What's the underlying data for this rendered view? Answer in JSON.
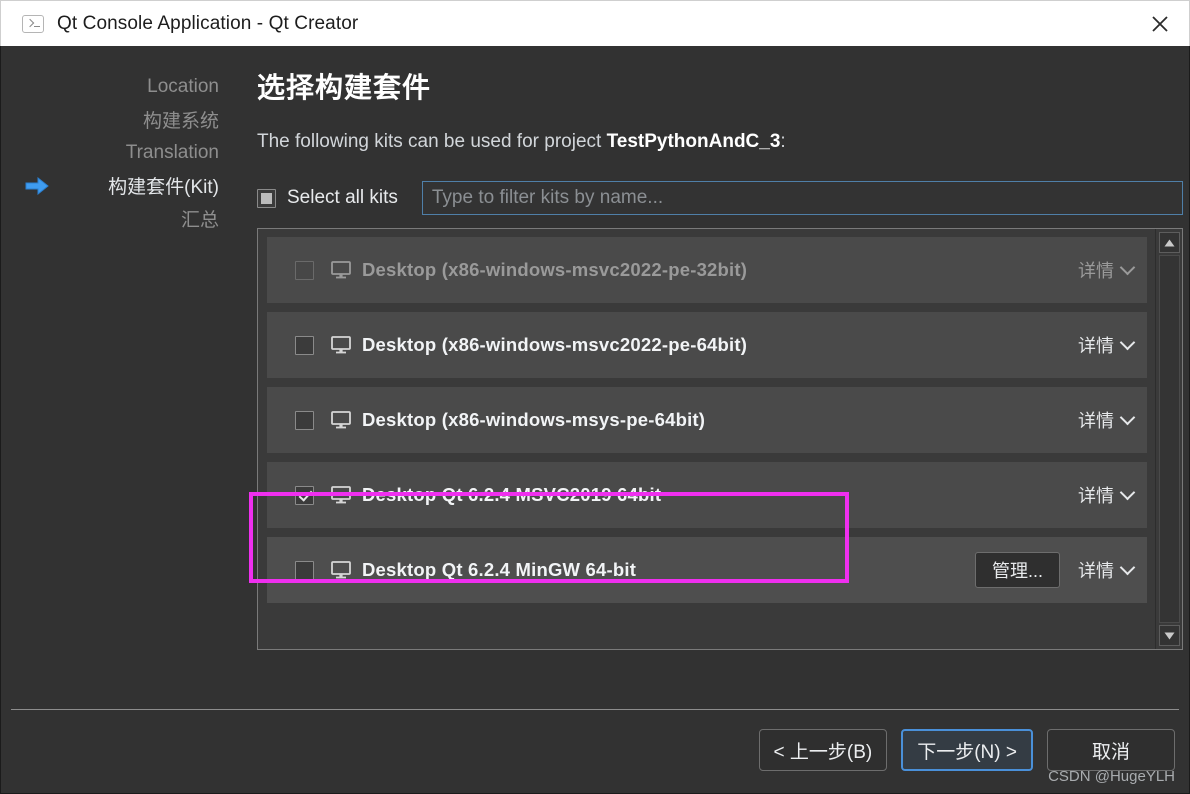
{
  "window": {
    "title": "Qt Console Application - Qt Creator",
    "icon": "console-icon",
    "close_label": "✕"
  },
  "sidebar": {
    "items": [
      {
        "label": "Location",
        "state": "done"
      },
      {
        "label": "构建系统",
        "state": "done"
      },
      {
        "label": "Translation",
        "state": "done"
      },
      {
        "label": "构建套件(Kit)",
        "state": "current"
      },
      {
        "label": "汇总",
        "state": "pending"
      }
    ]
  },
  "page": {
    "title": "选择构建套件",
    "subtitle_prefix": "The following kits can be used for project ",
    "project_name": "TestPythonAndC_3",
    "subtitle_suffix": ":"
  },
  "filter": {
    "select_all_label": "Select all kits",
    "select_all_state": "partial",
    "placeholder": "Type to filter kits by name...",
    "value": ""
  },
  "kits": {
    "details_label": "详情",
    "manage_label": "管理...",
    "rows": [
      {
        "label": "Desktop (x86-windows-msvc2022-pe-32bit)",
        "checked": false,
        "disabled": true,
        "hovered": false,
        "highlighted": false
      },
      {
        "label": "Desktop (x86-windows-msvc2022-pe-64bit)",
        "checked": false,
        "disabled": false,
        "hovered": false,
        "highlighted": false
      },
      {
        "label": "Desktop (x86-windows-msys-pe-64bit)",
        "checked": false,
        "disabled": false,
        "hovered": false,
        "highlighted": false
      },
      {
        "label": "Desktop Qt 6.2.4 MSVC2019 64bit",
        "checked": true,
        "disabled": false,
        "hovered": false,
        "highlighted": true
      },
      {
        "label": "Desktop Qt 6.2.4 MinGW 64-bit",
        "checked": false,
        "disabled": false,
        "hovered": true,
        "highlighted": false
      }
    ]
  },
  "footer": {
    "back_label": "< 上一步(B)",
    "back_mnemonic": "B",
    "next_label": "下一步(N) >",
    "next_mnemonic": "N",
    "cancel_label": "取消",
    "watermark": "CSDN @HugeYLH"
  },
  "colors": {
    "accent_focus": "#4a90d9",
    "annotation": "#ef2fef",
    "dialog_bg": "#323232",
    "list_bg": "#3a3a3a",
    "row_bg": "#4a4a4a",
    "titlebar_bg": "#ffffff"
  }
}
